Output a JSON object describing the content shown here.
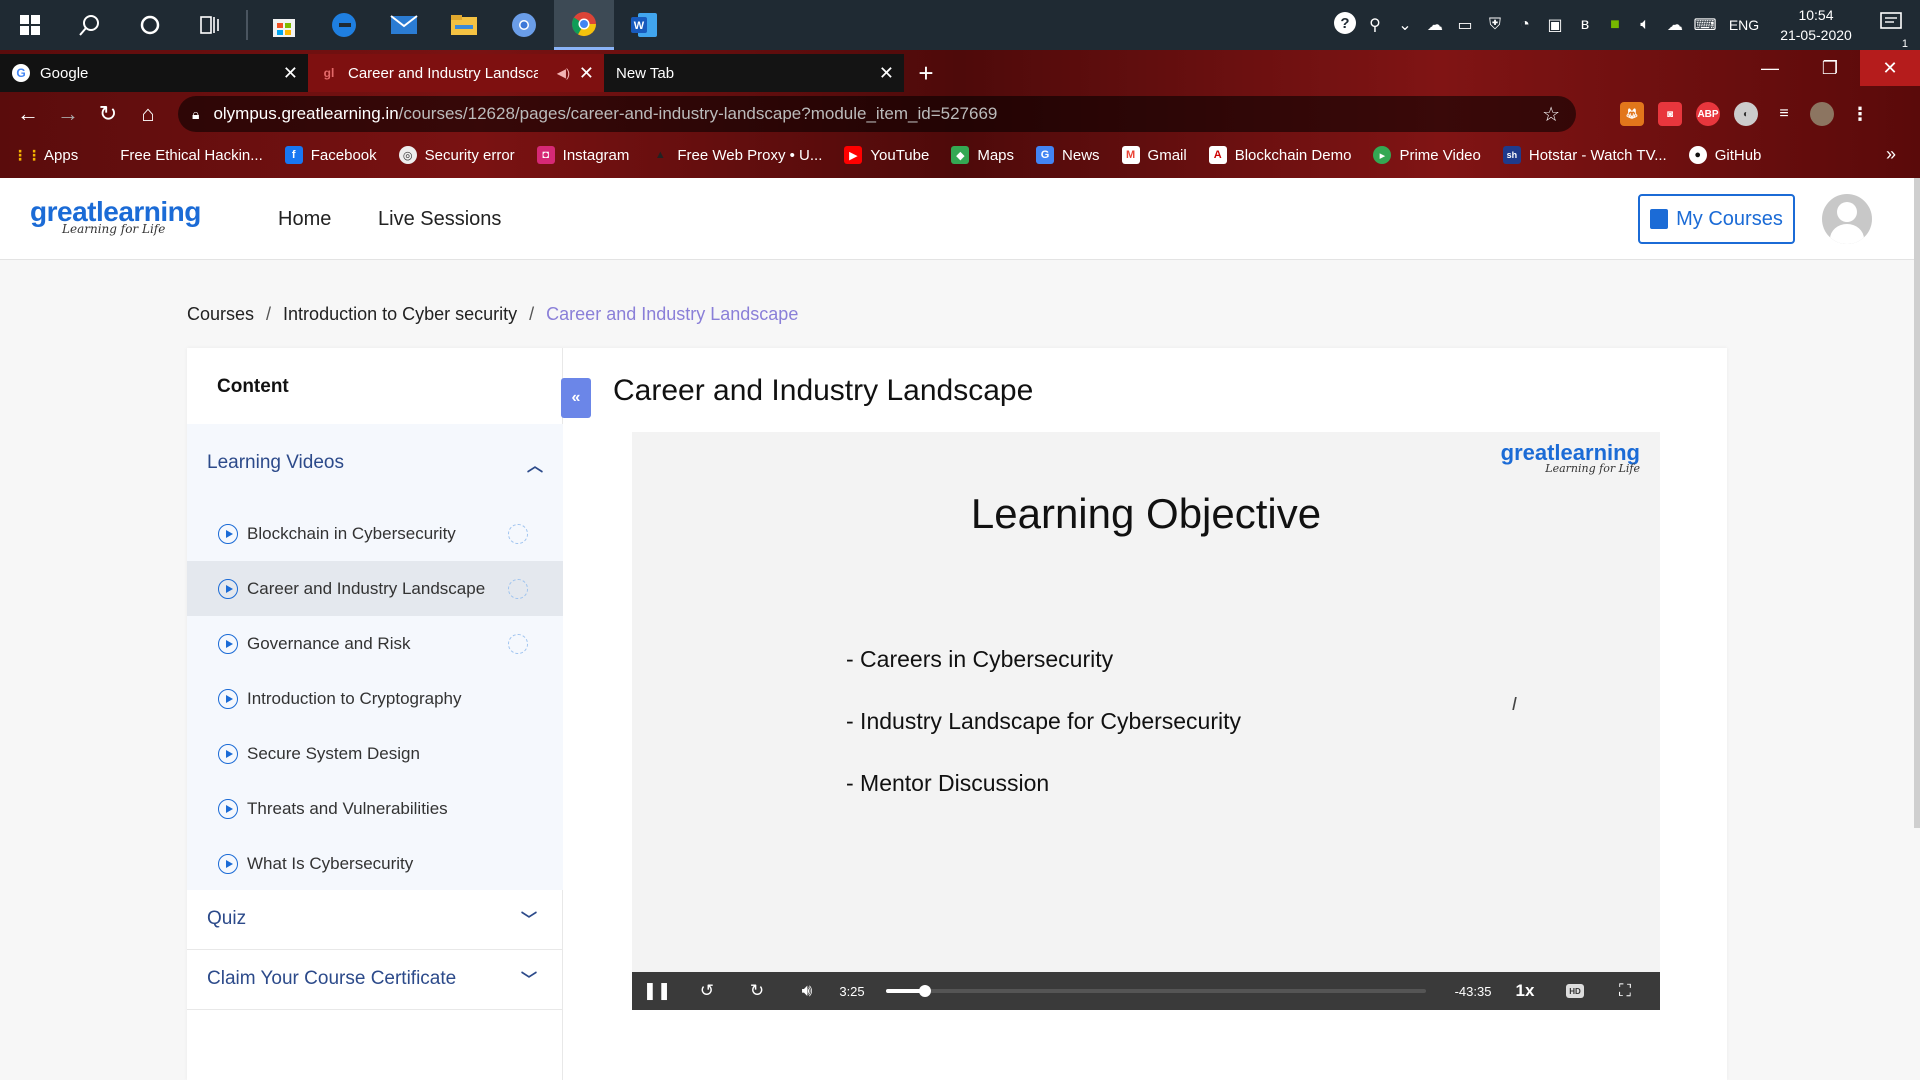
{
  "taskbar": {
    "apps": [
      "windows-start",
      "search",
      "cortana",
      "task-view",
      "microsoft-store",
      "edge",
      "mail",
      "file-explorer",
      "chromium",
      "chrome",
      "word"
    ],
    "tray": {
      "language": "ENG",
      "time": "10:54",
      "date": "21-05-2020",
      "notifications": "1"
    }
  },
  "browser": {
    "tabs": [
      {
        "title": "Google",
        "active": false
      },
      {
        "title": "Career and Industry Landsca",
        "active": true
      },
      {
        "title": "New Tab",
        "active": false
      }
    ],
    "url_host": "olympus.greatlearning.in",
    "url_path": "/courses/12628/pages/career-and-industry-landscape?module_item_id=527669",
    "bookmarks": [
      {
        "label": "Apps",
        "color": "#ea4335",
        "icon": "apps-grid-icon"
      },
      {
        "label": "Free Ethical Hackin...",
        "color": "transparent",
        "icon": "none"
      },
      {
        "label": "Facebook",
        "color": "#1877f2",
        "icon": "facebook-icon"
      },
      {
        "label": "Security error",
        "color": "#444444",
        "icon": "globe-icon"
      },
      {
        "label": "Instagram",
        "color": "#d62976",
        "icon": "instagram-icon"
      },
      {
        "label": "Free Web Proxy • U...",
        "color": "#333333",
        "icon": "proxy-icon"
      },
      {
        "label": "YouTube",
        "color": "#ff0000",
        "icon": "youtube-icon"
      },
      {
        "label": "Maps",
        "color": "#34a853",
        "icon": "maps-icon"
      },
      {
        "label": "News",
        "color": "#4285f4",
        "icon": "news-icon"
      },
      {
        "label": "Gmail",
        "color": "#ea4335",
        "icon": "gmail-icon"
      },
      {
        "label": "Blockchain Demo",
        "color": "#cc0000",
        "icon": "adobe-icon"
      },
      {
        "label": "Prime Video",
        "color": "#34a853",
        "icon": "prime-video-icon"
      },
      {
        "label": "Hotstar - Watch TV...",
        "color": "#1f3b8c",
        "icon": "hotstar-icon"
      },
      {
        "label": "GitHub",
        "color": "#111111",
        "icon": "github-icon"
      }
    ]
  },
  "site": {
    "logo_main": "greatlearning",
    "logo_tagline": "Learning for Life",
    "nav": [
      "Home",
      "Live Sessions"
    ],
    "my_courses": "My Courses"
  },
  "breadcrumb": {
    "items": [
      "Courses",
      "Introduction to Cyber security",
      "Career and Industry Landscape"
    ],
    "separator": "/"
  },
  "sidebar": {
    "title": "Content",
    "open_section": {
      "title": "Learning Videos",
      "lessons": [
        {
          "label": "Blockchain in Cybersecurity",
          "status": true
        },
        {
          "label": "Career and Industry Landscape",
          "status": true
        },
        {
          "label": "Governance and Risk",
          "status": true
        },
        {
          "label": "Introduction to Cryptography",
          "status": false
        },
        {
          "label": "Secure System Design",
          "status": false
        },
        {
          "label": "Threats and Vulnerabilities",
          "status": false
        },
        {
          "label": "What Is Cybersecurity",
          "status": false
        }
      ],
      "active_index": 1
    },
    "closed_sections": [
      "Quiz",
      "Claim Your Course Certificate"
    ]
  },
  "main": {
    "title": "Career and Industry Landscape",
    "slide": {
      "logo_main": "greatlearning",
      "logo_tagline": "Learning for Life",
      "heading": "Learning Objective",
      "bullets": [
        "- Careers in Cybersecurity",
        "- Industry Landscape for Cybersecurity",
        "- Mentor Discussion"
      ]
    },
    "player": {
      "elapsed": "3:25",
      "remaining": "-43:35",
      "progress_fraction": 0.073,
      "speed": "1x",
      "quality": "HD"
    }
  },
  "colors": {
    "brand_blue": "#1b6bd6",
    "breadcrumb_current": "#8a7fd8",
    "section_text": "#2c4a8a",
    "collapse_button": "#6b86e8"
  }
}
